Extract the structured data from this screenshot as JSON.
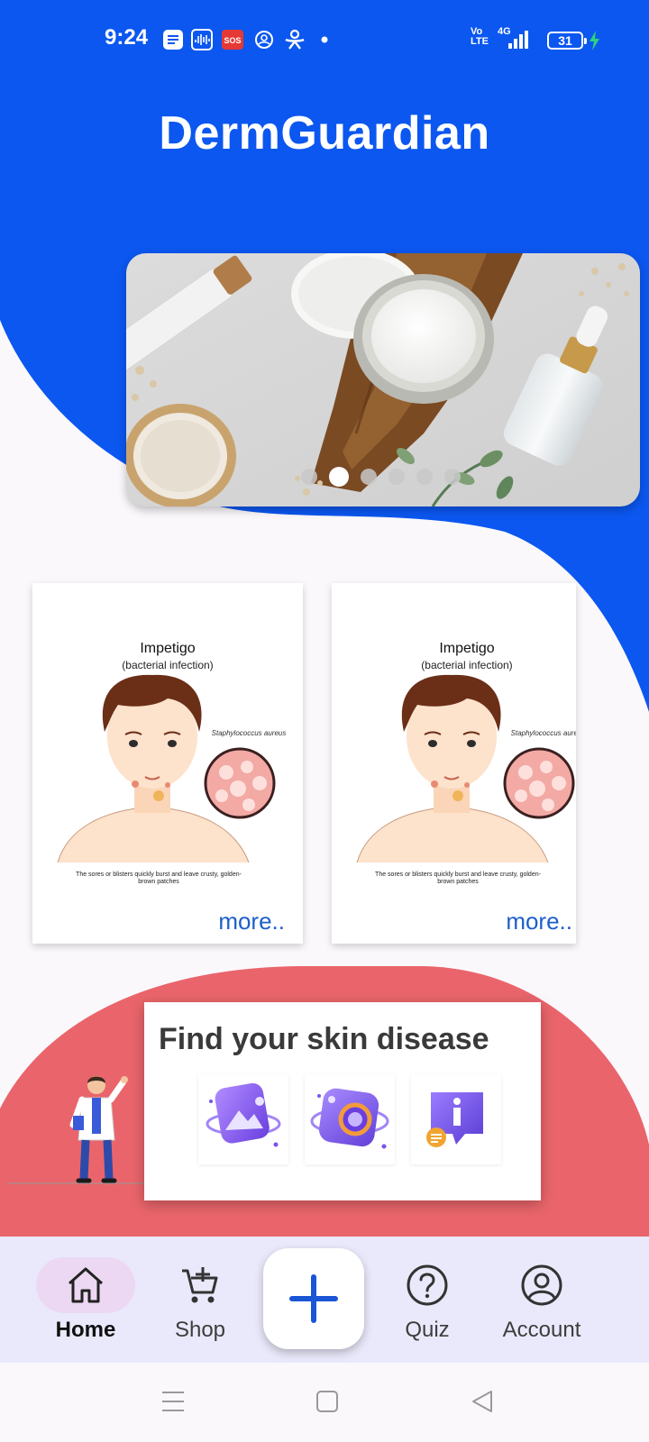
{
  "status_bar": {
    "time": "9:24",
    "icons": [
      "notes-icon",
      "voice-recorder-icon",
      "sos-icon",
      "care-icon",
      "assistant-icon",
      "dot-icon"
    ],
    "sos_label": "SOS",
    "volte_line1": "Vo",
    "volte_line2": "LTE",
    "network": "4G",
    "battery": "31"
  },
  "app": {
    "title": "DermGuardian",
    "brand_blue": "#0b57f0",
    "coral": "#e9656b"
  },
  "carousel": {
    "total_slides": 6,
    "active_index": 1
  },
  "info_cards": [
    {
      "title": "Impetigo",
      "subtitle": "(bacterial infection)",
      "organism": "Staphylococcus aureus",
      "note": "The sores or blisters quickly burst and leave crusty, golden-brown patches",
      "more_label": "more.."
    },
    {
      "title": "Impetigo",
      "subtitle": "(bacterial infection)",
      "organism": "Staphylococcus aureus",
      "note": "The sores or blisters quickly burst and leave crusty, golden-brown patches",
      "more_label": "more.."
    }
  ],
  "find": {
    "title": "Find your skin disease",
    "tools": [
      "gallery-icon",
      "camera-icon",
      "info-icon"
    ]
  },
  "bottom_nav": {
    "items": [
      {
        "label": "Home",
        "icon": "home-icon",
        "active": true
      },
      {
        "label": "Shop",
        "icon": "cart-add-icon",
        "active": false
      },
      {
        "label": "Quiz",
        "icon": "question-icon",
        "active": false
      },
      {
        "label": "Account",
        "icon": "account-icon",
        "active": false
      }
    ],
    "fab_icon": "plus-icon"
  },
  "system_nav": [
    "menu-icon",
    "home-square-icon",
    "back-icon"
  ]
}
